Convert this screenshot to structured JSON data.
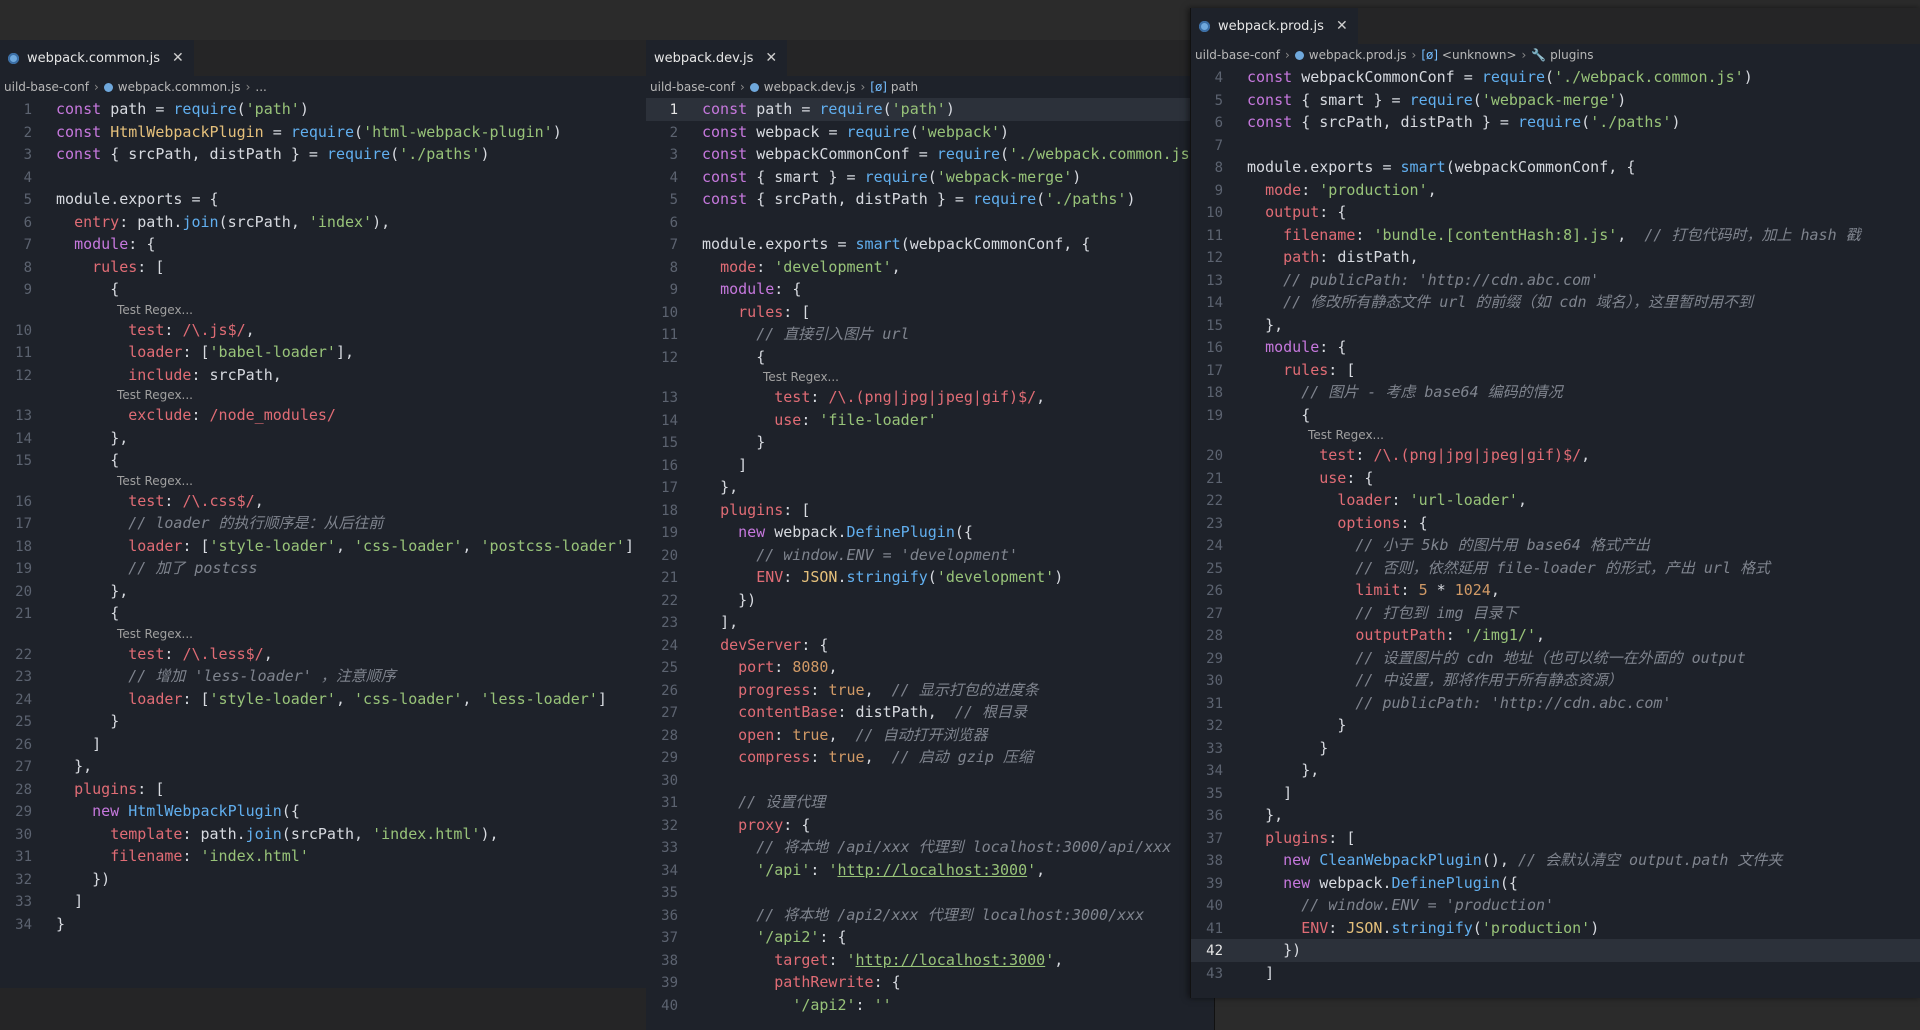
{
  "panes": {
    "common": {
      "tab": "webpack.common.js",
      "breadcrumb": [
        "uild-base-conf",
        "webpack.common.js",
        "..."
      ],
      "lines": [
        {
          "n": "1",
          "code": "const path = require('path')"
        },
        {
          "n": "2",
          "code": "const HtmlWebpackPlugin = require('html-webpack-plugin')"
        },
        {
          "n": "3",
          "code": "const { srcPath, distPath } = require('./paths')"
        },
        {
          "n": "4",
          "code": ""
        },
        {
          "n": "5",
          "code": "module.exports = {"
        },
        {
          "n": "6",
          "code": "  entry: path.join(srcPath, 'index'),"
        },
        {
          "n": "7",
          "code": "  module: {"
        },
        {
          "n": "8",
          "code": "    rules: ["
        },
        {
          "n": "9",
          "code": "      {"
        },
        {
          "lens": "Test Regex..."
        },
        {
          "n": "10",
          "code": "        test: /\\.js$/,"
        },
        {
          "n": "11",
          "code": "        loader: ['babel-loader'],"
        },
        {
          "n": "12",
          "code": "        include: srcPath,"
        },
        {
          "lens": "Test Regex..."
        },
        {
          "n": "13",
          "code": "        exclude: /node_modules/"
        },
        {
          "n": "14",
          "code": "      },"
        },
        {
          "n": "15",
          "code": "      {"
        },
        {
          "lens": "Test Regex..."
        },
        {
          "n": "16",
          "code": "        test: /\\.css$/,"
        },
        {
          "n": "17",
          "code": "        // loader 的执行顺序是：从后往前"
        },
        {
          "n": "18",
          "code": "        loader: ['style-loader', 'css-loader', 'postcss-loader']"
        },
        {
          "n": "19",
          "code": "        // 加了 postcss"
        },
        {
          "n": "20",
          "code": "      },"
        },
        {
          "n": "21",
          "code": "      {"
        },
        {
          "lens": "Test Regex..."
        },
        {
          "n": "22",
          "code": "        test: /\\.less$/,"
        },
        {
          "n": "23",
          "code": "        // 增加 'less-loader' ，注意顺序"
        },
        {
          "n": "24",
          "code": "        loader: ['style-loader', 'css-loader', 'less-loader']"
        },
        {
          "n": "25",
          "code": "      }"
        },
        {
          "n": "26",
          "code": "    ]"
        },
        {
          "n": "27",
          "code": "  },"
        },
        {
          "n": "28",
          "code": "  plugins: ["
        },
        {
          "n": "29",
          "code": "    new HtmlWebpackPlugin({"
        },
        {
          "n": "30",
          "code": "      template: path.join(srcPath, 'index.html'),"
        },
        {
          "n": "31",
          "code": "      filename: 'index.html'"
        },
        {
          "n": "32",
          "code": "    })"
        },
        {
          "n": "33",
          "code": "  ]"
        },
        {
          "n": "34",
          "code": "}"
        }
      ]
    },
    "dev": {
      "tab": "webpack.dev.js",
      "breadcrumb": [
        "uild-base-conf",
        "webpack.dev.js",
        "path"
      ],
      "lines": [
        {
          "n": "1",
          "code": "const path = require('path')",
          "active": true
        },
        {
          "n": "2",
          "code": "const webpack = require('webpack')"
        },
        {
          "n": "3",
          "code": "const webpackCommonConf = require('./webpack.common.js')"
        },
        {
          "n": "4",
          "code": "const { smart } = require('webpack-merge')"
        },
        {
          "n": "5",
          "code": "const { srcPath, distPath } = require('./paths')"
        },
        {
          "n": "6",
          "code": ""
        },
        {
          "n": "7",
          "code": "module.exports = smart(webpackCommonConf, {"
        },
        {
          "n": "8",
          "code": "  mode: 'development',"
        },
        {
          "n": "9",
          "code": "  module: {"
        },
        {
          "n": "10",
          "code": "    rules: ["
        },
        {
          "n": "11",
          "code": "      // 直接引入图片 url"
        },
        {
          "n": "12",
          "code": "      {"
        },
        {
          "lens": "Test Regex..."
        },
        {
          "n": "13",
          "code": "        test: /\\.(png|jpg|jpeg|gif)$/,"
        },
        {
          "n": "14",
          "code": "        use: 'file-loader'"
        },
        {
          "n": "15",
          "code": "      }"
        },
        {
          "n": "16",
          "code": "    ]"
        },
        {
          "n": "17",
          "code": "  },"
        },
        {
          "n": "18",
          "code": "  plugins: ["
        },
        {
          "n": "19",
          "code": "    new webpack.DefinePlugin({"
        },
        {
          "n": "20",
          "code": "      // window.ENV = 'development'"
        },
        {
          "n": "21",
          "code": "      ENV: JSON.stringify('development')"
        },
        {
          "n": "22",
          "code": "    })"
        },
        {
          "n": "23",
          "code": "  ],"
        },
        {
          "n": "24",
          "code": "  devServer: {"
        },
        {
          "n": "25",
          "code": "    port: 8080,"
        },
        {
          "n": "26",
          "code": "    progress: true,  // 显示打包的进度条"
        },
        {
          "n": "27",
          "code": "    contentBase: distPath,  // 根目录"
        },
        {
          "n": "28",
          "code": "    open: true,  // 自动打开浏览器"
        },
        {
          "n": "29",
          "code": "    compress: true,  // 启动 gzip 压缩"
        },
        {
          "n": "30",
          "code": ""
        },
        {
          "n": "31",
          "code": "    // 设置代理"
        },
        {
          "n": "32",
          "code": "    proxy: {"
        },
        {
          "n": "33",
          "code": "      // 将本地 /api/xxx 代理到 localhost:3000/api/xxx"
        },
        {
          "n": "34",
          "code": "      '/api': 'http://localhost:3000',"
        },
        {
          "n": "35",
          "code": ""
        },
        {
          "n": "36",
          "code": "      // 将本地 /api2/xxx 代理到 localhost:3000/xxx"
        },
        {
          "n": "37",
          "code": "      '/api2': {"
        },
        {
          "n": "38",
          "code": "        target: 'http://localhost:3000',"
        },
        {
          "n": "39",
          "code": "        pathRewrite: {"
        },
        {
          "n": "40",
          "code": "          '/api2': ''"
        }
      ]
    },
    "prod": {
      "tab": "webpack.prod.js",
      "breadcrumb": [
        "uild-base-conf",
        "webpack.prod.js",
        "<unknown>",
        "plugins"
      ],
      "lines": [
        {
          "n": "4",
          "code": "const webpackCommonConf = require('./webpack.common.js')"
        },
        {
          "n": "5",
          "code": "const { smart } = require('webpack-merge')"
        },
        {
          "n": "6",
          "code": "const { srcPath, distPath } = require('./paths')"
        },
        {
          "n": "7",
          "code": ""
        },
        {
          "n": "8",
          "code": "module.exports = smart(webpackCommonConf, {"
        },
        {
          "n": "9",
          "code": "  mode: 'production',"
        },
        {
          "n": "10",
          "code": "  output: {"
        },
        {
          "n": "11",
          "code": "    filename: 'bundle.[contentHash:8].js',  // 打包代码时，加上 hash 戳"
        },
        {
          "n": "12",
          "code": "    path: distPath,"
        },
        {
          "n": "13",
          "code": "    // publicPath: 'http://cdn.abc.com'"
        },
        {
          "n": "14",
          "code": "    // 修改所有静态文件 url 的前缀（如 cdn 域名），这里暂时用不到"
        },
        {
          "n": "15",
          "code": "  },"
        },
        {
          "n": "16",
          "code": "  module: {"
        },
        {
          "n": "17",
          "code": "    rules: ["
        },
        {
          "n": "18",
          "code": "      // 图片 - 考虑 base64 编码的情况"
        },
        {
          "n": "19",
          "code": "      {"
        },
        {
          "lens": "Test Regex..."
        },
        {
          "n": "20",
          "code": "        test: /\\.(png|jpg|jpeg|gif)$/,"
        },
        {
          "n": "21",
          "code": "        use: {"
        },
        {
          "n": "22",
          "code": "          loader: 'url-loader',"
        },
        {
          "n": "23",
          "code": "          options: {"
        },
        {
          "n": "24",
          "code": "            // 小于 5kb 的图片用 base64 格式产出"
        },
        {
          "n": "25",
          "code": "            // 否则，依然延用 file-loader 的形式，产出 url 格式"
        },
        {
          "n": "26",
          "code": "            limit: 5 * 1024,"
        },
        {
          "n": "27",
          "code": "            // 打包到 img 目录下"
        },
        {
          "n": "28",
          "code": "            outputPath: '/img1/',"
        },
        {
          "n": "29",
          "code": "            // 设置图片的 cdn 地址（也可以统一在外面的 output"
        },
        {
          "n": "30",
          "code": "            // 中设置，那将作用于所有静态资源）"
        },
        {
          "n": "31",
          "code": "            // publicPath: 'http://cdn.abc.com'"
        },
        {
          "n": "32",
          "code": "          }"
        },
        {
          "n": "33",
          "code": "        }"
        },
        {
          "n": "34",
          "code": "      },"
        },
        {
          "n": "35",
          "code": "    ]"
        },
        {
          "n": "36",
          "code": "  },"
        },
        {
          "n": "37",
          "code": "  plugins: ["
        },
        {
          "n": "38",
          "code": "    new CleanWebpackPlugin(), // 会默认清空 output.path 文件夹"
        },
        {
          "n": "39",
          "code": "    new webpack.DefinePlugin({"
        },
        {
          "n": "40",
          "code": "      // window.ENV = 'production'"
        },
        {
          "n": "41",
          "code": "      ENV: JSON.stringify('production')"
        },
        {
          "n": "42",
          "code": "    })",
          "active": true
        },
        {
          "n": "43",
          "code": "  ]"
        }
      ]
    }
  }
}
